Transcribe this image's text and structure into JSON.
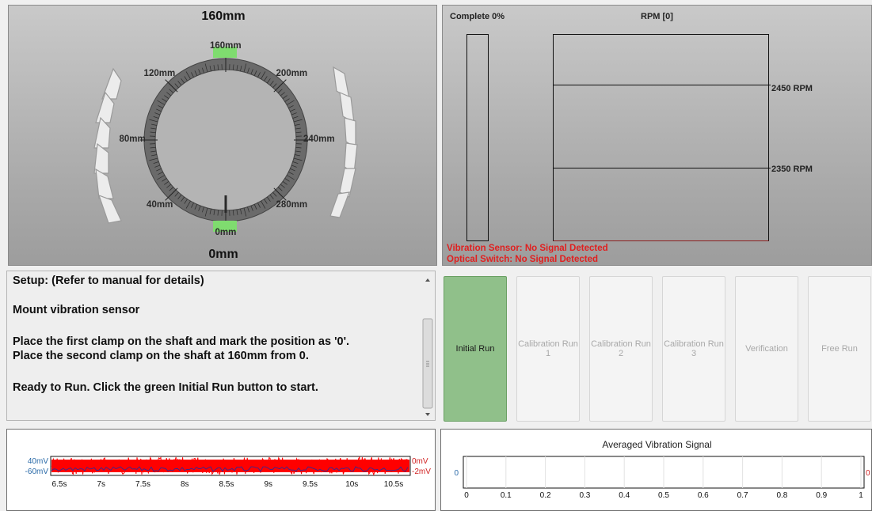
{
  "dial": {
    "top_label": "160mm",
    "bottom_label": "0mm",
    "marks": [
      {
        "text": "160mm",
        "ang": 0
      },
      {
        "text": "120mm",
        "ang": -45
      },
      {
        "text": "200mm",
        "ang": 45
      },
      {
        "text": "80mm",
        "ang": -90
      },
      {
        "text": "240mm",
        "ang": 90
      },
      {
        "text": "40mm",
        "ang": -135
      },
      {
        "text": "280mm",
        "ang": 135
      },
      {
        "text": "0mm",
        "ang": 180
      }
    ],
    "clamp_color": "#7fdc6f"
  },
  "progress": {
    "complete_label": "Complete 0%",
    "rpm_label": "RPM [0]",
    "rpm_upper": "2450 RPM",
    "rpm_lower": "2350 RPM",
    "vibration_warning": "Vibration Sensor: No Signal Detected",
    "optical_warning": "Optical Switch: No Signal Detected",
    "warning_color": "#e02020"
  },
  "setup": {
    "heading": "Setup: (Refer to manual for details)",
    "line1": "Mount vibration sensor",
    "line2": "Place the first clamp on the shaft and mark the position as '0'.",
    "line3": "Place the second clamp on the shaft at 160mm from 0.",
    "line4": "Ready to Run. Click the green Initial Run button to start."
  },
  "steps": [
    {
      "label": "Initial Run",
      "active": true
    },
    {
      "label": "Calibration Run 1",
      "active": false
    },
    {
      "label": "Calibration Run 2",
      "active": false
    },
    {
      "label": "Calibration Run 3",
      "active": false
    },
    {
      "label": "Verification",
      "active": false
    },
    {
      "label": "Free Run",
      "active": false
    }
  ],
  "waveform": {
    "left_top": "40mV",
    "left_bottom": "-60mV",
    "right_top": "0mV",
    "right_bottom": "-2mV",
    "x_ticks": [
      "6.5s",
      "7s",
      "7.5s",
      "8s",
      "8.5s",
      "9s",
      "9.5s",
      "10s",
      "10.5s"
    ],
    "trace_color": "#ff0000",
    "alt_trace_color": "#1a2ea8"
  },
  "avg_chart": {
    "title": "Averaged Vibration Signal",
    "y_left": "0",
    "y_right": "0",
    "x_ticks": [
      "0",
      "0.1",
      "0.2",
      "0.3",
      "0.4",
      "0.5",
      "0.6",
      "0.7",
      "0.8",
      "0.9",
      "1"
    ]
  }
}
